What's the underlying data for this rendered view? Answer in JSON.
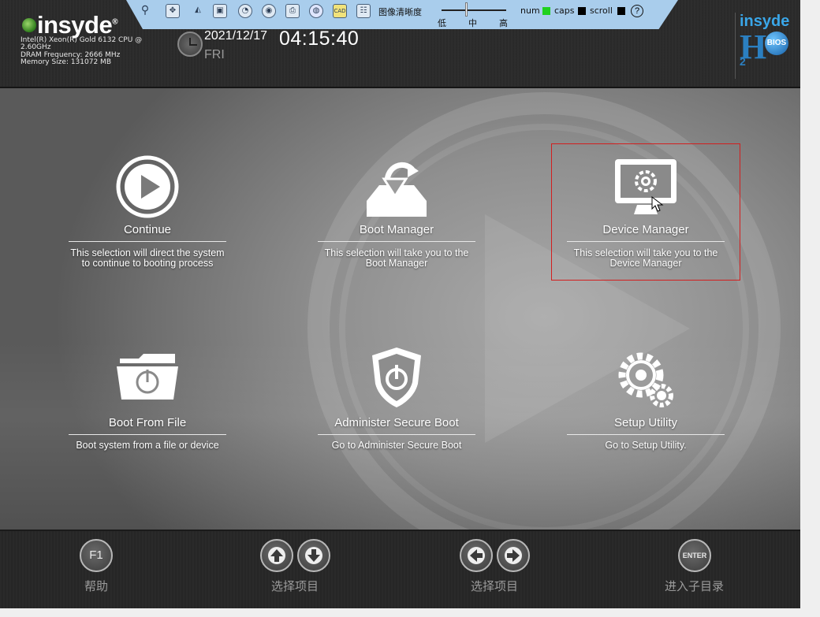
{
  "header": {
    "logo": "insyde",
    "cpu": "Intel(R) Xeon(R) Gold 6132 CPU @ 2.60GHz",
    "dram": "DRAM Frequency: 2666 MHz",
    "memory": "Memory Size: 131072 MB",
    "date": "2021/12/17",
    "time": "04:15:40",
    "day": "FRI",
    "brand_top": "insyde",
    "brand_h": "H",
    "brand_2": "2",
    "brand_bios": "BIOS"
  },
  "toolbar": {
    "image_quality_label": "图像清晰度",
    "level_low": "低",
    "level_mid": "中",
    "level_high": "高",
    "num_label": "num",
    "caps_label": "caps",
    "scroll_label": "scroll",
    "num_color": "#1fd11f",
    "caps_color": "#000000",
    "scroll_color": "#000000",
    "help_glyph": "?",
    "icons": [
      "pin-icon",
      "move-icon",
      "fit-icon",
      "screenshot-icon",
      "disk-icon",
      "floppy-icon",
      "usb-icon",
      "cd-icon",
      "keys-icon",
      "settings-icon"
    ]
  },
  "tiles": [
    {
      "title": "Continue",
      "desc": "This selection will direct the system to continue to booting process"
    },
    {
      "title": "Boot Manager",
      "desc": "This selection will take you to the Boot Manager"
    },
    {
      "title": "Device Manager",
      "desc": "This selection will take you to the Device Manager"
    },
    {
      "title": "Boot From File",
      "desc": "Boot system from a file or device"
    },
    {
      "title": "Administer Secure Boot",
      "desc": "Go to Administer Secure Boot"
    },
    {
      "title": "Setup Utility",
      "desc": "Go to Setup Utility."
    }
  ],
  "selected_tile": "Device Manager",
  "selection_color": "#d21f1f",
  "footer": {
    "f1_key": "F1",
    "help_label": "帮助",
    "select_item_label_1": "选择项目",
    "select_item_label_2": "选择项目",
    "enter_key": "ENTER",
    "enter_label": "进入子目录"
  }
}
